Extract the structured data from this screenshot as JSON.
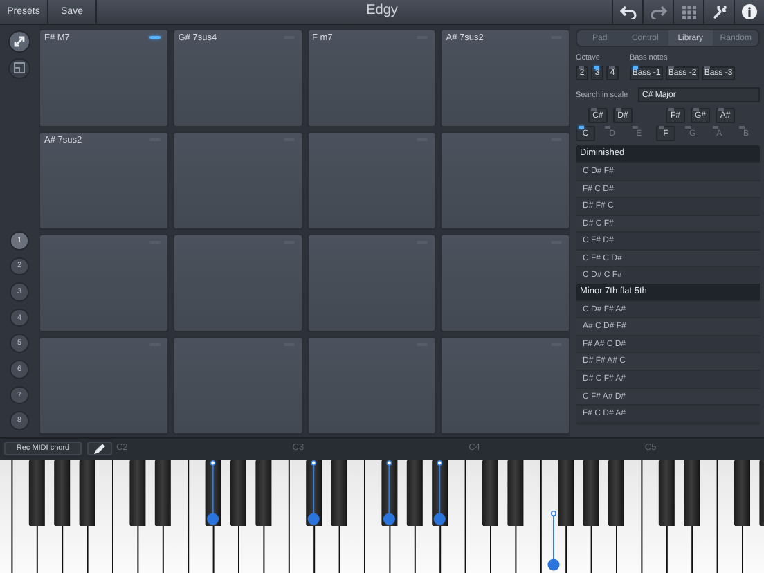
{
  "top_bar": {
    "buttons": [
      "Presets",
      "Save"
    ],
    "title": "Edgy"
  },
  "tools": [
    {
      "selected": true
    },
    {
      "selected": false
    }
  ],
  "banks": [
    {
      "label": "1",
      "selected": true
    },
    {
      "label": "2",
      "selected": false
    },
    {
      "label": "3",
      "selected": false
    },
    {
      "label": "4",
      "selected": false
    },
    {
      "label": "5",
      "selected": false
    },
    {
      "label": "6",
      "selected": false
    },
    {
      "label": "7",
      "selected": false
    },
    {
      "label": "8",
      "selected": false
    }
  ],
  "pads": [
    {
      "label": "F# M7",
      "selected": true
    },
    {
      "label": "G# 7sus4",
      "selected": false
    },
    {
      "label": "F m7",
      "selected": false
    },
    {
      "label": "A# 7sus2",
      "selected": false
    },
    {
      "label": "A# 7sus2",
      "selected": false
    },
    {
      "selected": false
    },
    {
      "selected": false
    },
    {
      "selected": false
    },
    {
      "selected": false
    },
    {
      "selected": false
    },
    {
      "selected": false
    },
    {
      "selected": false
    },
    {
      "selected": false
    },
    {
      "selected": false
    },
    {
      "selected": false
    },
    {
      "selected": false
    }
  ],
  "panel": {
    "tabs": [
      {
        "label": "Pad",
        "selected": false
      },
      {
        "label": "Control",
        "selected": false
      },
      {
        "label": "Library",
        "selected": true
      },
      {
        "label": "Random",
        "selected": false
      }
    ],
    "octave": {
      "label": "Octave",
      "options": [
        {
          "label": "2",
          "selected": false
        },
        {
          "label": "3",
          "selected": true
        },
        {
          "label": "4",
          "selected": false
        }
      ]
    },
    "bass": {
      "label": "Bass notes",
      "options": [
        {
          "label": "Bass -1",
          "selected": true
        },
        {
          "label": "Bass -2",
          "selected": false
        },
        {
          "label": "Bass -3",
          "selected": false
        }
      ]
    },
    "search": {
      "label": "Search in scale",
      "value": "C# Major"
    },
    "sharp_notes": [
      {
        "label": "C#",
        "in_scale": true,
        "selected": false
      },
      {
        "label": "D#",
        "in_scale": true,
        "selected": false
      },
      {
        "label": "F#",
        "in_scale": true,
        "selected": false
      },
      {
        "label": "G#",
        "in_scale": true,
        "selected": false
      },
      {
        "label": "A#",
        "in_scale": true,
        "selected": false
      }
    ],
    "natural_notes": [
      {
        "label": "C",
        "in_scale": true,
        "selected": true
      },
      {
        "label": "D",
        "in_scale": false,
        "selected": false
      },
      {
        "label": "E",
        "in_scale": false,
        "selected": false
      },
      {
        "label": "F",
        "in_scale": true,
        "selected": false
      },
      {
        "label": "G",
        "in_scale": false,
        "selected": false
      },
      {
        "label": "A",
        "in_scale": false,
        "selected": false
      },
      {
        "label": "B",
        "in_scale": false,
        "selected": false
      }
    ],
    "chord_list": [
      {
        "kind": "header",
        "label": "Diminished"
      },
      {
        "kind": "item",
        "label": "C D# F#"
      },
      {
        "kind": "item",
        "label": "F# C D#"
      },
      {
        "kind": "item",
        "label": "D# F# C"
      },
      {
        "kind": "item",
        "label": "D# C F#"
      },
      {
        "kind": "item",
        "label": "C F# D#"
      },
      {
        "kind": "item",
        "label": "C F# C D#"
      },
      {
        "kind": "item",
        "label": "C D# C F#"
      },
      {
        "kind": "header",
        "label": "Minor 7th flat 5th"
      },
      {
        "kind": "item",
        "label": "C D# F# A#"
      },
      {
        "kind": "item",
        "label": "A# C D# F#"
      },
      {
        "kind": "item",
        "label": "F# A# C D#"
      },
      {
        "kind": "item",
        "label": "D# F# A# C"
      },
      {
        "kind": "item",
        "label": "D# C F# A#"
      },
      {
        "kind": "item",
        "label": "C F# A# D#"
      },
      {
        "kind": "item",
        "label": "F# C D# A#"
      }
    ]
  },
  "keyboard": {
    "rec_button": "Rec MIDI chord",
    "keys": [
      {
        "marked": false
      },
      {
        "marked": false,
        "sharp": {
          "marked": false
        }
      },
      {
        "marked": false,
        "sharp": {
          "marked": false
        }
      },
      {
        "marked": false,
        "sharp": {
          "marked": false
        }
      },
      {
        "marked": false
      },
      {
        "label": "C2",
        "marked": false,
        "sharp": {
          "marked": false
        }
      },
      {
        "marked": false,
        "sharp": {
          "marked": false
        }
      },
      {
        "marked": false
      },
      {
        "marked": false,
        "sharp": {
          "marked": true
        }
      },
      {
        "marked": false,
        "sharp": {
          "marked": false
        }
      },
      {
        "marked": false,
        "sharp": {
          "marked": false
        }
      },
      {
        "marked": false
      },
      {
        "label": "C3",
        "marked": false,
        "sharp": {
          "marked": true
        }
      },
      {
        "marked": false,
        "sharp": {
          "marked": false
        }
      },
      {
        "marked": false
      },
      {
        "marked": false,
        "sharp": {
          "marked": true
        }
      },
      {
        "marked": false,
        "sharp": {
          "marked": false
        }
      },
      {
        "marked": false,
        "sharp": {
          "marked": true
        }
      },
      {
        "marked": false
      },
      {
        "label": "C4",
        "marked": false,
        "sharp": {
          "marked": false
        }
      },
      {
        "marked": false,
        "sharp": {
          "marked": false
        }
      },
      {
        "marked": false
      },
      {
        "marked": true,
        "sharp": {
          "marked": false
        }
      },
      {
        "marked": false,
        "sharp": {
          "marked": false
        }
      },
      {
        "marked": false,
        "sharp": {
          "marked": false
        }
      },
      {
        "marked": false
      },
      {
        "label": "C5",
        "marked": false,
        "sharp": {
          "marked": false
        }
      },
      {
        "marked": false,
        "sharp": {
          "marked": false
        }
      },
      {
        "marked": false
      },
      {
        "marked": false,
        "sharp": {
          "marked": false
        }
      },
      {
        "marked": false,
        "sharp": {
          "marked": false
        }
      }
    ]
  }
}
